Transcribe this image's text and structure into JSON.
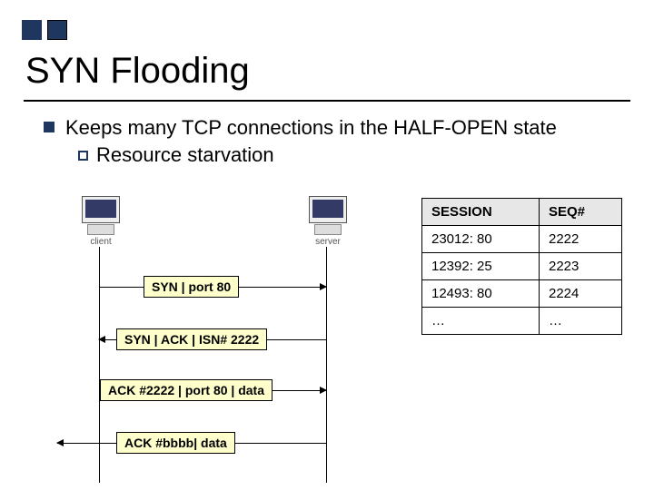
{
  "title": "SYN Flooding",
  "bullets": {
    "main": "Keeps many TCP connections in the HALF-OPEN state",
    "sub": "Resource starvation"
  },
  "hosts": {
    "client_label": "client",
    "server_label": "server"
  },
  "messages": {
    "m1": "SYN | port 80",
    "m2": "SYN | ACK | ISN# 2222",
    "m3": "ACK #2222 | port 80 | data",
    "m4": "ACK #bbbb| data"
  },
  "table": {
    "headers": {
      "session": "SESSION",
      "seq": "SEQ#"
    },
    "rows": [
      {
        "session": "23012: 80",
        "seq": "2222"
      },
      {
        "session": "12392: 25",
        "seq": "2223"
      },
      {
        "session": "12493: 80",
        "seq": "2224"
      },
      {
        "session": "…",
        "seq": "…"
      }
    ]
  }
}
